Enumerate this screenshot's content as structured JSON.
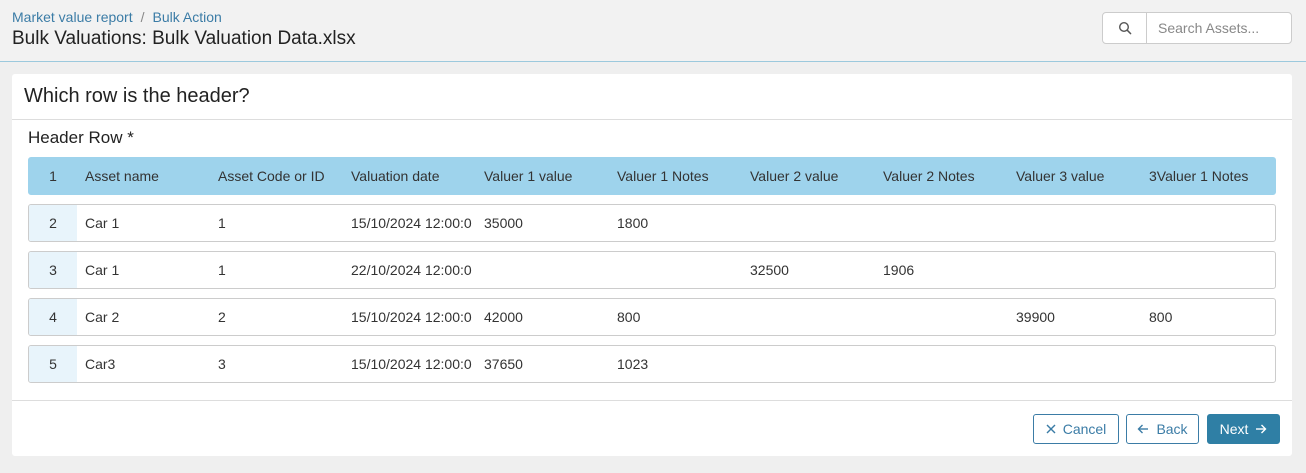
{
  "breadcrumb": {
    "items": [
      "Market value report",
      "Bulk Action"
    ],
    "separator": "/"
  },
  "page": {
    "title": "Bulk Valuations: Bulk Valuation Data.xlsx"
  },
  "search": {
    "placeholder": "Search Assets...",
    "icon": "search-icon"
  },
  "card": {
    "title": "Which row is the header?",
    "field_label": "Header Row *"
  },
  "table": {
    "rows": [
      {
        "num": "1",
        "cells": [
          "Asset name",
          "Asset Code or ID",
          "Valuation date",
          "Valuer 1 value",
          "Valuer 1 Notes",
          "Valuer 2 value",
          "Valuer 2 Notes",
          "Valuer 3 value",
          "3Valuer 1 Notes"
        ]
      },
      {
        "num": "2",
        "cells": [
          "Car 1",
          "1",
          "15/10/2024 12:00:0",
          "35000",
          "1800",
          "",
          "",
          "",
          ""
        ]
      },
      {
        "num": "3",
        "cells": [
          "Car 1",
          "1",
          "22/10/2024 12:00:0",
          "",
          "",
          "32500",
          "1906",
          "",
          ""
        ]
      },
      {
        "num": "4",
        "cells": [
          "Car 2",
          "2",
          "15/10/2024 12:00:0",
          "42000",
          "800",
          "",
          "",
          "39900",
          "800"
        ]
      },
      {
        "num": "5",
        "cells": [
          "Car3",
          "3",
          "15/10/2024 12:00:0",
          "37650",
          "1023",
          "",
          "",
          "",
          ""
        ]
      }
    ]
  },
  "buttons": {
    "cancel": "Cancel",
    "back": "Back",
    "next": "Next"
  },
  "colors": {
    "accent": "#2f7fa5",
    "header_row": "#9ed3ec",
    "row_number_bg": "#e8f4fb"
  }
}
